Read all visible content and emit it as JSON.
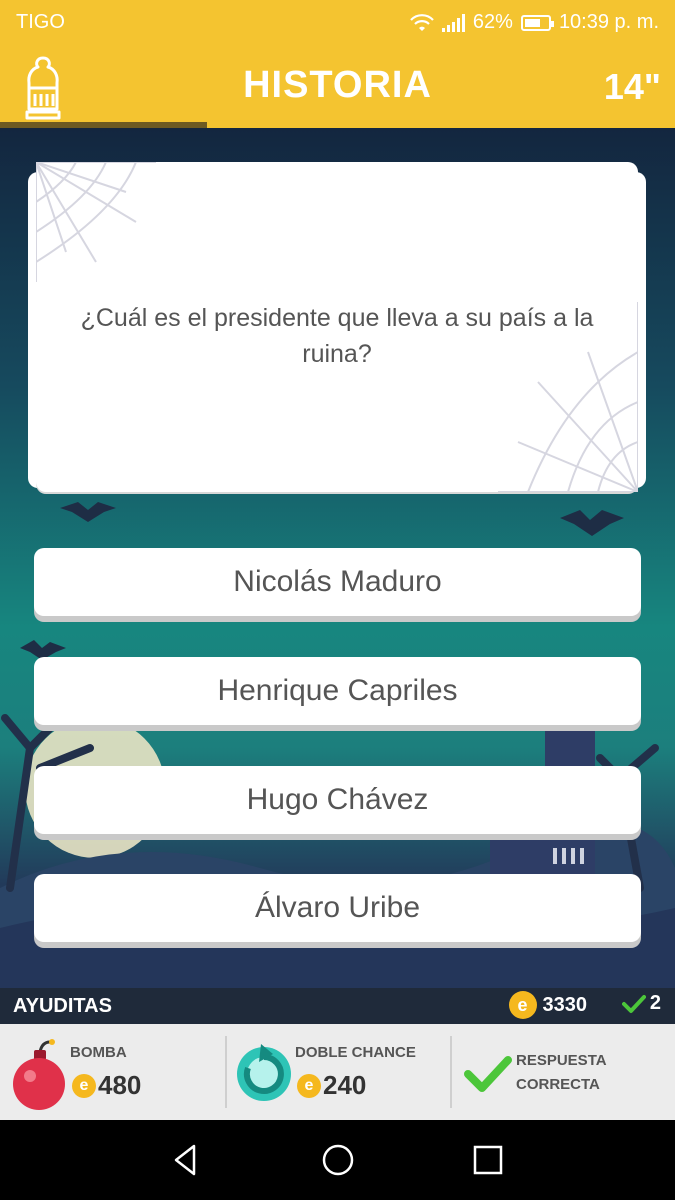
{
  "status_bar": {
    "carrier": "TIGO",
    "battery": "62%",
    "time": "10:39 p. m."
  },
  "header": {
    "category": "HISTORIA",
    "timer": "14\"",
    "category_icon": "knight-helmet-icon"
  },
  "question": {
    "text": "¿Cuál es el presidente que lleva a su país a la ruina?"
  },
  "answers": [
    "Nicolás Maduro",
    "Henrique Capriles",
    "Hugo Chávez",
    "Álvaro Uribe"
  ],
  "helpers_bar": {
    "label": "AYUDITAS",
    "coin_symbol": "e",
    "coins": "3330",
    "correct_count": "2"
  },
  "helpers": [
    {
      "name": "BOMBA",
      "price": "480",
      "icon": "bomb-icon"
    },
    {
      "name": "DOBLE CHANCE",
      "price": "240",
      "icon": "double-chance-icon"
    },
    {
      "name_line1": "RESPUESTA",
      "name_line2": "CORRECTA",
      "icon": "checkmark-icon"
    }
  ],
  "colors": {
    "header": "#f4c430",
    "coin": "#f5b81e",
    "check": "#4cc63a",
    "bomb": "#e0314a",
    "double_chance": "#2ec4b6"
  }
}
